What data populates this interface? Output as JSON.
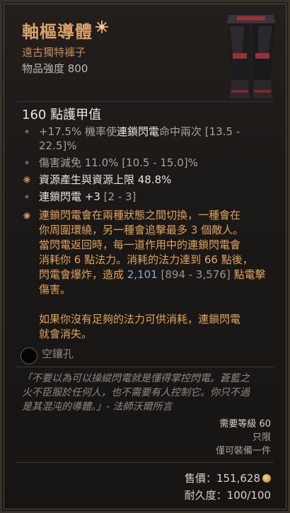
{
  "item": {
    "name": "軸樞導體",
    "type": "遠古獨特褲子",
    "power": "物品強度 800",
    "armor": "160 點護甲值"
  },
  "affixes": [
    {
      "text_prefix": "+17.5% 機率使",
      "text_highlight": "連鎖閃電",
      "text_suffix": "命中兩次 [13.5 -",
      "line2": "22.5]%"
    },
    {
      "text": "傷害減免 11.0% [10.5 - 15.0]%"
    },
    {
      "text": "資源產生與資源上限 48.8%"
    },
    {
      "text_main": "連鎖閃電 +3",
      "text_range": " [2 - 3]"
    }
  ],
  "unique_power": {
    "lines": [
      "連鎖閃電會在兩種狀態之間切換，一種會在",
      "你周圍環繞，另一種會追擊最多 3 個敵人。",
      "當閃電返回時，每一道作用中的連鎖閃電會",
      "消耗你 6 點法力。消耗的法力達到 66 點後，"
    ],
    "line5_a": "閃電會爆炸，造成 ",
    "line5_value": "2,101",
    "line5_range": " [894 - 3,576] ",
    "line5_b": "點電擊",
    "line6": "傷害。",
    "line7": "如果你沒有足夠的法力可供消耗，連鎖閃電",
    "line8": "就會消失。"
  },
  "socket": {
    "label": "空鑲孔"
  },
  "flavor": {
    "lines": [
      "「不要以為可以操縱閃電就是懂得掌控閃電。蒼藍之",
      "火不臣服於任何人，也不需要有人控制它。你只不過",
      "是其混沌的導體。」- 法師沃爾所言"
    ]
  },
  "requirements": {
    "level": "需要等級 60",
    "class": "只限",
    "equip": "僅可裝備一件"
  },
  "price": {
    "label": "售價：",
    "value": "151,628"
  },
  "durability": {
    "label": "耐久度：",
    "value": "100/100"
  },
  "colors": {
    "unique": "#d9a26a",
    "affix_orange": "#e2a25c",
    "value_blue": "#8fa3e0"
  }
}
